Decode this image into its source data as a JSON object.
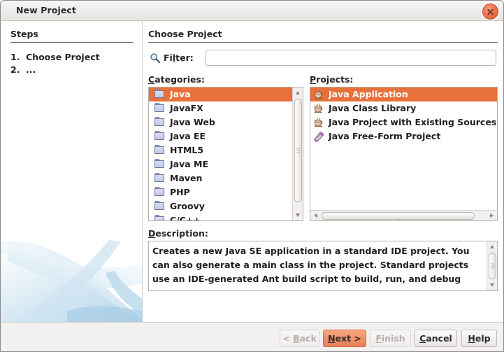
{
  "window": {
    "title": "New Project",
    "close_icon": "close-icon"
  },
  "steps": {
    "header": "Steps",
    "items": [
      {
        "num": "1.",
        "label": "Choose Project"
      },
      {
        "num": "2.",
        "label": "..."
      }
    ]
  },
  "content": {
    "title": "Choose Project",
    "filter": {
      "icon": "search-icon",
      "label_before": "Fi",
      "label_mnemonic": "l",
      "label_after": "ter:",
      "value": "",
      "placeholder": ""
    },
    "categories": {
      "label_mnemonic": "C",
      "label_rest": "ategories:",
      "selected_index": 0,
      "items": [
        {
          "label": "Java",
          "icon": "folder-icon"
        },
        {
          "label": "JavaFX",
          "icon": "folder-icon"
        },
        {
          "label": "Java Web",
          "icon": "folder-icon"
        },
        {
          "label": "Java EE",
          "icon": "folder-icon"
        },
        {
          "label": "HTML5",
          "icon": "folder-icon"
        },
        {
          "label": "Java ME",
          "icon": "folder-icon"
        },
        {
          "label": "Maven",
          "icon": "folder-icon"
        },
        {
          "label": "PHP",
          "icon": "folder-icon"
        },
        {
          "label": "Groovy",
          "icon": "folder-icon"
        },
        {
          "label": "C/C++",
          "icon": "folder-icon"
        }
      ]
    },
    "projects": {
      "label_mnemonic": "P",
      "label_rest": "rojects:",
      "selected_index": 0,
      "items": [
        {
          "label": "Java Application",
          "icon": "java-coffee-icon"
        },
        {
          "label": "Java Class Library",
          "icon": "java-coffee-icon"
        },
        {
          "label": "Java Project with Existing Sources",
          "icon": "java-coffee-icon"
        },
        {
          "label": "Java Free-Form Project",
          "icon": "freeform-project-icon"
        }
      ]
    },
    "description": {
      "label_mnemonic": "D",
      "label_rest": "escription:",
      "text": "Creates a new Java SE application in a standard IDE project. You can also generate a main class in the project. Standard projects use an IDE-generated Ant build script to build, run, and debug"
    }
  },
  "buttons": {
    "back": {
      "prefix": "< ",
      "mnemonic": "B",
      "rest": "ack",
      "enabled": false,
      "default": false
    },
    "next": {
      "prefix": "",
      "mnemonic": "N",
      "rest": "ext >",
      "enabled": true,
      "default": true
    },
    "finish": {
      "prefix": "",
      "mnemonic": "F",
      "rest": "inish",
      "enabled": false,
      "default": false
    },
    "cancel": {
      "prefix": "",
      "mnemonic": "C",
      "rest": "ancel",
      "enabled": true,
      "default": false
    },
    "help": {
      "prefix": "",
      "mnemonic": "H",
      "rest": "elp",
      "enabled": true,
      "default": false
    }
  },
  "colors": {
    "selection": "#e8703a",
    "default_button": "#ea7f59",
    "close_button": "#ec7350",
    "titlebar": "#eeecea",
    "panel": "#f2f1ef"
  }
}
